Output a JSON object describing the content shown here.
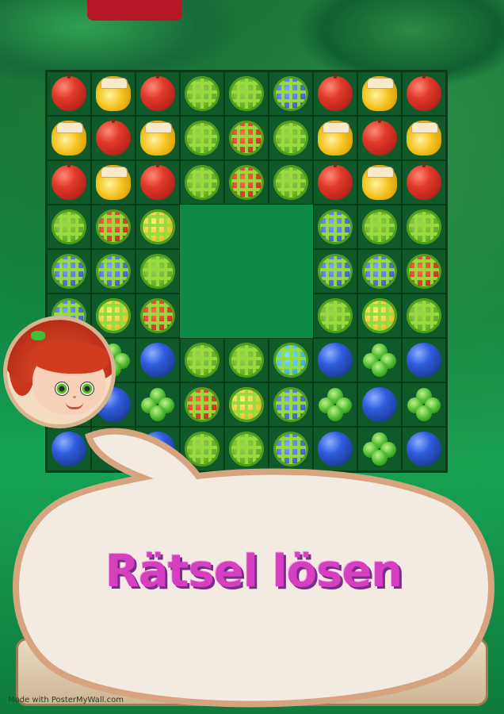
{
  "board": {
    "rows": [
      [
        "apple",
        "honey",
        "apple",
        "cage-green",
        "cage-green",
        "cage-blue",
        "apple",
        "honey",
        "apple"
      ],
      [
        "honey",
        "apple",
        "honey",
        "cage-green",
        "cage-red",
        "cage-green",
        "honey",
        "apple",
        "honey"
      ],
      [
        "apple",
        "honey",
        "apple",
        "cage-green",
        "cage-red",
        "cage-green",
        "apple",
        "honey",
        "apple"
      ],
      [
        "cage-green",
        "cage-red",
        "cage-yellow",
        "empty",
        "empty",
        "empty",
        "cage-blue",
        "cage-green",
        "cage-green"
      ],
      [
        "cage-blue",
        "cage-blue",
        "cage-green",
        "empty",
        "empty",
        "empty",
        "cage-blue",
        "cage-blue",
        "cage-red"
      ],
      [
        "cage-blue",
        "cage-yellow",
        "cage-red",
        "empty",
        "empty",
        "empty",
        "cage-green",
        "cage-yellow",
        "cage-green"
      ],
      [
        "clover",
        "clover",
        "blueberry",
        "cage-green",
        "cage-green",
        "cage-teal",
        "blueberry",
        "clover",
        "blueberry"
      ],
      [
        "blueberry",
        "blueberry",
        "clover",
        "cage-red",
        "cage-yellow",
        "cage-blue",
        "clover",
        "blueberry",
        "clover"
      ],
      [
        "blueberry",
        "clover",
        "blueberry",
        "cage-green",
        "cage-green",
        "cage-blue",
        "blueberry",
        "clover",
        "blueberry"
      ]
    ]
  },
  "speech_bubble": {
    "text": "Rätsel lösen"
  },
  "watermark": "Made with PosterMyWall.com",
  "colors": {
    "bubble_fill": "#f3ebe2",
    "bubble_border": "#d6a47e",
    "text_color": "#d53fc0"
  }
}
